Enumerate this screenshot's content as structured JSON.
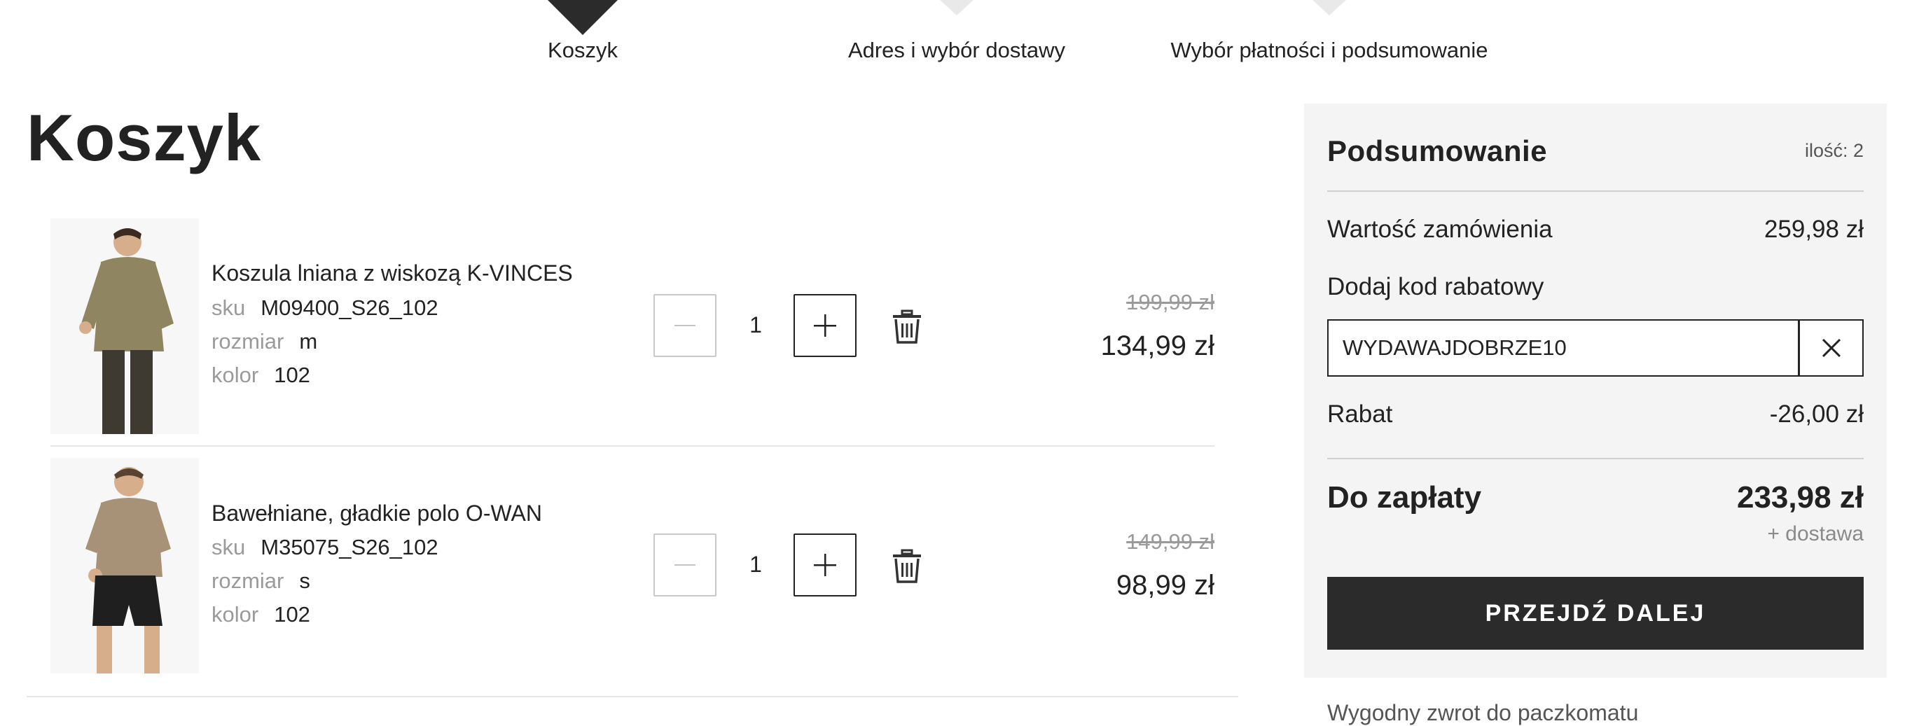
{
  "stepper": {
    "steps": [
      {
        "label": "Koszyk",
        "active": true
      },
      {
        "label": "Adres i wybór dostawy",
        "active": false
      },
      {
        "label": "Wybór płatności i podsumowanie",
        "active": false
      }
    ]
  },
  "cart": {
    "title": "Koszyk",
    "meta_labels": {
      "sku": "sku",
      "size": "rozmiar",
      "color": "kolor"
    },
    "items": [
      {
        "name": "Koszula lniana z wiskozą K-VINCES",
        "sku": "M09400_S26_102",
        "size": "m",
        "color": "102",
        "quantity": "1",
        "old_price": "199,99 zł",
        "price": "134,99 zł",
        "image_colors": {
          "top": "#8f8560",
          "bottom": "#3e3a32",
          "skin": "#d7ae8c"
        }
      },
      {
        "name": "Bawełniane, gładkie polo O-WAN",
        "sku": "M35075_S26_102",
        "size": "s",
        "color": "102",
        "quantity": "1",
        "old_price": "149,99 zł",
        "price": "98,99 zł",
        "image_colors": {
          "top": "#a89277",
          "bottom": "#1f1f1f",
          "skin": "#d7ae8c"
        }
      }
    ]
  },
  "summary": {
    "title": "Podsumowanie",
    "count": "ilość: 2",
    "order_value_label": "Wartość zamówienia",
    "order_value": "259,98 zł",
    "discount_code_label": "Dodaj kod rabatowy",
    "discount_code_value": "WYDAWAJDOBRZE10",
    "discount_label": "Rabat",
    "discount_value": "-26,00 zł",
    "total_label": "Do zapłaty",
    "total_value": "233,98 zł",
    "shipping_note": "+ dostawa",
    "proceed_label": "PRZEJDŹ DALEJ",
    "return_note": "Wygodny zwrot do paczkomatu"
  },
  "colors": {
    "accent": "#2b2b2b",
    "summary_bg": "#f4f4f4",
    "muted": "#9a9a9a"
  },
  "icons": [
    "minus-icon",
    "plus-icon",
    "trash-icon",
    "close-icon"
  ]
}
